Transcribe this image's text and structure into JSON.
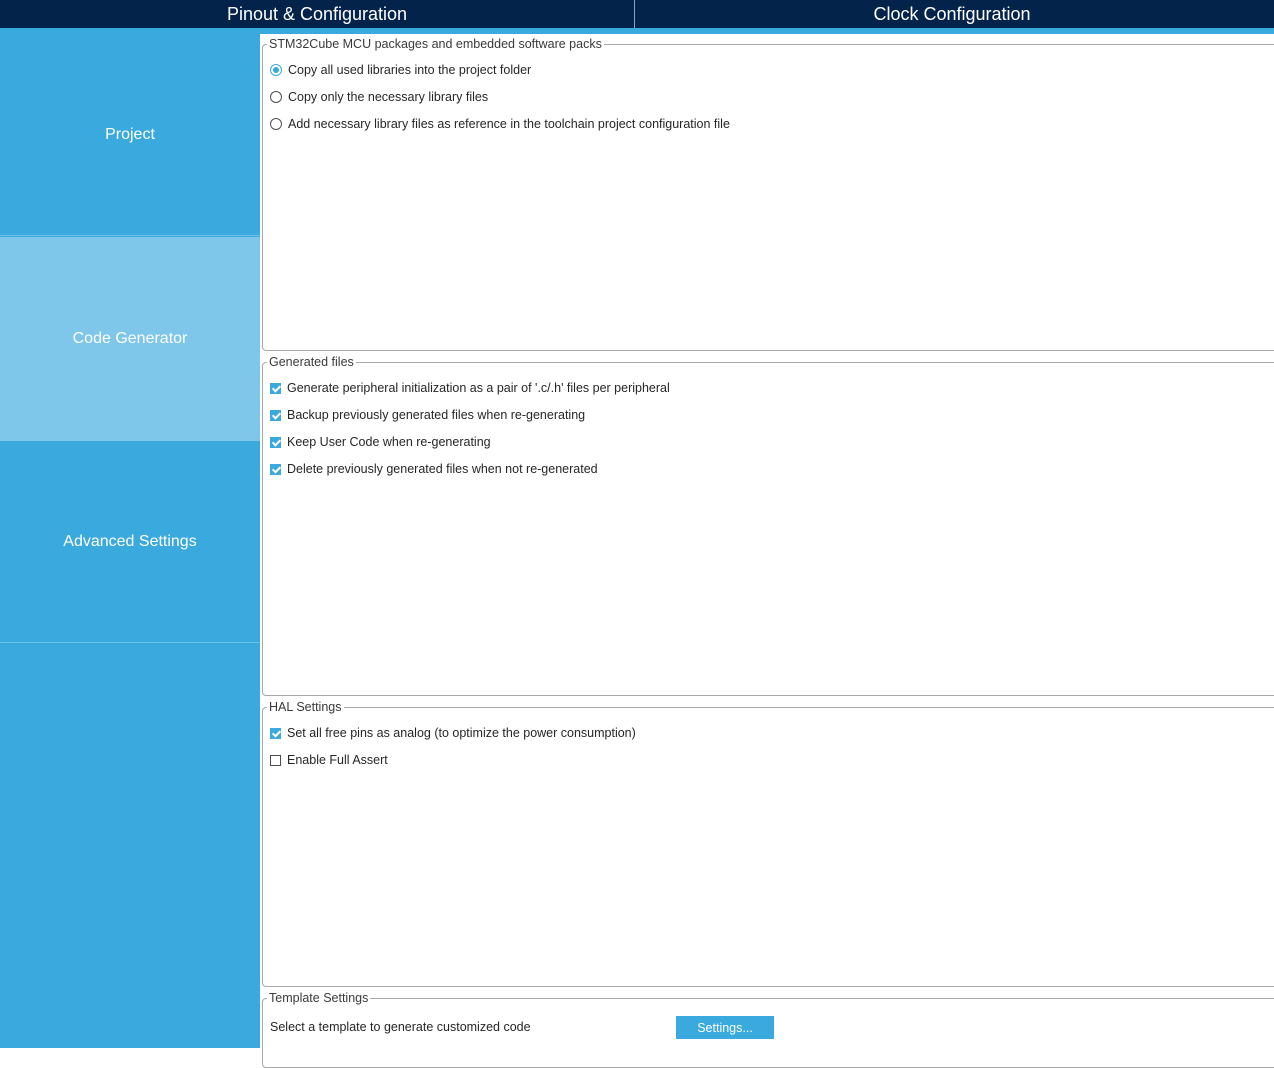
{
  "top_tabs": [
    {
      "label": "Pinout & Configuration"
    },
    {
      "label": "Clock Configuration"
    }
  ],
  "sidebar": {
    "items": [
      {
        "label": "Project",
        "selected": false
      },
      {
        "label": "Code Generator",
        "selected": true
      },
      {
        "label": "Advanced Settings",
        "selected": false
      }
    ]
  },
  "mcu_packages": {
    "title": "STM32Cube MCU packages and embedded software packs",
    "options": [
      {
        "label": "Copy all used libraries into the project folder",
        "selected": true
      },
      {
        "label": "Copy only the necessary library files",
        "selected": false
      },
      {
        "label": "Add necessary library files as reference in the toolchain project configuration file",
        "selected": false
      }
    ]
  },
  "generated_files": {
    "title": "Generated files",
    "options": [
      {
        "label": "Generate peripheral initialization as a pair of '.c/.h' files per peripheral",
        "checked": true
      },
      {
        "label": "Backup previously generated files when re-generating",
        "checked": true
      },
      {
        "label": "Keep User Code when re-generating",
        "checked": true
      },
      {
        "label": "Delete previously generated files when not re-generated",
        "checked": true
      }
    ]
  },
  "hal_settings": {
    "title": "HAL Settings",
    "options": [
      {
        "label": "Set all free pins as analog (to optimize the power consumption)",
        "checked": true
      },
      {
        "label": "Enable Full Assert",
        "checked": false
      }
    ]
  },
  "template_settings": {
    "title": "Template Settings",
    "label": "Select a template to generate customized code",
    "button_label": "Settings..."
  },
  "colors": {
    "header_bg": "#03234b",
    "accent": "#3aa9dd",
    "sidebar_selected": "#7ec6ea"
  }
}
